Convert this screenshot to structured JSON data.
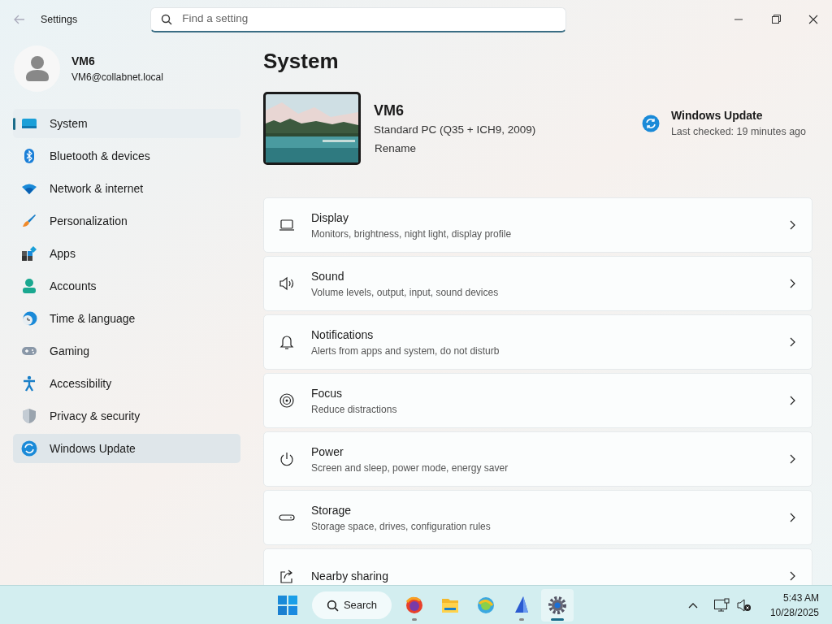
{
  "window": {
    "title": "Settings",
    "search": {
      "placeholder": "Find a setting"
    }
  },
  "account": {
    "name": "VM6",
    "email": "VM6@collabnet.local"
  },
  "sidebar": {
    "items": [
      {
        "label": "System",
        "selected": true,
        "hovered": false
      },
      {
        "label": "Bluetooth & devices",
        "selected": false,
        "hovered": false
      },
      {
        "label": "Network & internet",
        "selected": false,
        "hovered": false
      },
      {
        "label": "Personalization",
        "selected": false,
        "hovered": false
      },
      {
        "label": "Apps",
        "selected": false,
        "hovered": false
      },
      {
        "label": "Accounts",
        "selected": false,
        "hovered": false
      },
      {
        "label": "Time & language",
        "selected": false,
        "hovered": false
      },
      {
        "label": "Gaming",
        "selected": false,
        "hovered": false
      },
      {
        "label": "Accessibility",
        "selected": false,
        "hovered": false
      },
      {
        "label": "Privacy & security",
        "selected": false,
        "hovered": false
      },
      {
        "label": "Windows Update",
        "selected": false,
        "hovered": true
      }
    ]
  },
  "page": {
    "title": "System",
    "device": {
      "name": "VM6",
      "model": "Standard PC (Q35 + ICH9, 2009)",
      "rename": "Rename"
    },
    "update": {
      "title": "Windows Update",
      "status": "Last checked: 19 minutes ago"
    },
    "cards": [
      {
        "title": "Display",
        "description": "Monitors, brightness, night light, display profile"
      },
      {
        "title": "Sound",
        "description": "Volume levels, output, input, sound devices"
      },
      {
        "title": "Notifications",
        "description": "Alerts from apps and system, do not disturb"
      },
      {
        "title": "Focus",
        "description": "Reduce distractions"
      },
      {
        "title": "Power",
        "description": "Screen and sleep, power mode, energy saver"
      },
      {
        "title": "Storage",
        "description": "Storage space, drives, configuration rules"
      },
      {
        "title": "Nearby sharing"
      }
    ]
  },
  "taskbar": {
    "search": "Search",
    "apps": [
      {
        "running": true,
        "selected": false
      },
      {
        "running": false,
        "selected": false
      },
      {
        "running": false,
        "selected": false
      },
      {
        "running": true,
        "selected": false
      },
      {
        "running": true,
        "selected": true
      }
    ],
    "time": "5:43 AM",
    "date": "10/28/2025"
  }
}
